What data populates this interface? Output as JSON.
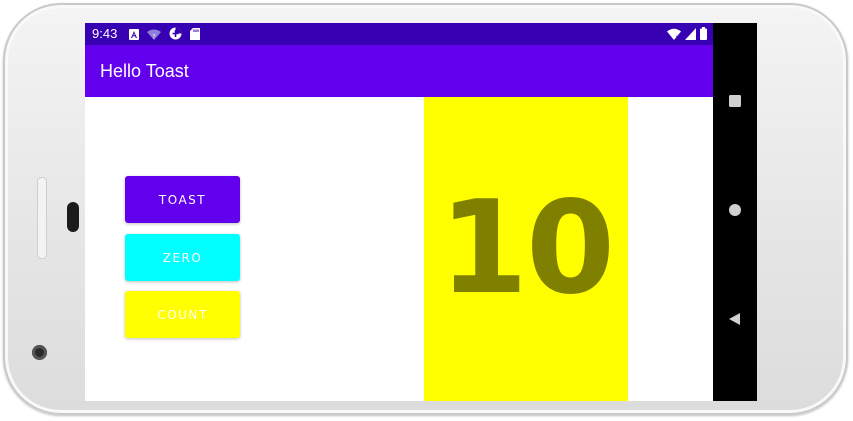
{
  "status_bar": {
    "time": "9:43",
    "left_icons": [
      "a-notification-icon",
      "wifi-question-icon",
      "data-saver-icon",
      "sd-card-icon"
    ],
    "right_icons": [
      "wifi-x-icon",
      "signal-icon",
      "battery-icon"
    ]
  },
  "app_bar": {
    "title": "Hello Toast"
  },
  "buttons": {
    "toast_label": "TOAST",
    "zero_label": "ZERO",
    "count_label": "COUNT"
  },
  "counter": {
    "value": "10"
  },
  "colors": {
    "status_bar": "#3700b3",
    "app_bar": "#6200ee",
    "toast_button": "#6200ee",
    "zero_button": "#00ffff",
    "count_button": "#ffff00",
    "count_panel": "#ffff00",
    "count_text": "#808000",
    "nav_bar": "#000000"
  },
  "nav_bar": {
    "buttons": [
      "recents-icon",
      "home-icon",
      "back-icon"
    ]
  }
}
